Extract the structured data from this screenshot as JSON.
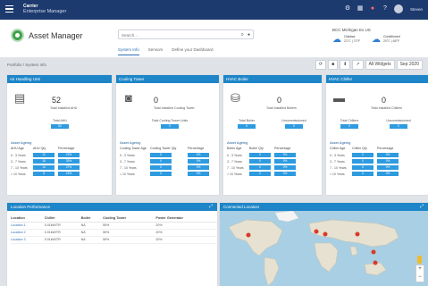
{
  "topbar": {
    "brand_line1": "Carrier",
    "brand_line2": "Enterprise Manager",
    "user_name": "Steven",
    "icons": [
      "settings-icon",
      "grid-icon",
      "alert-icon",
      "help-icon"
    ]
  },
  "header": {
    "app_title": "Asset Manager",
    "search_placeholder": "Search...",
    "tabs": [
      "System Info",
      "Sensors",
      "Define your Dashboard"
    ],
    "site_name": "BCC Michigan Ex US",
    "weather": [
      {
        "label": "Outdoor",
        "value": "21°C | 70°F"
      },
      {
        "label": "Conditioned",
        "value": "20°C | 68°F"
      }
    ]
  },
  "breadcrumb": "Portfolio / System Info",
  "toolbar": {
    "widgets_label": "All Widgets",
    "date_label": "Sep 2020"
  },
  "cards": [
    {
      "title": "Air Handling Unit",
      "icon": "ahu-icon",
      "count": "52",
      "count_label": "Total Installed AHU",
      "sub_label": "Total AHU",
      "sub_value": "52",
      "aging_title": "Asset Ageing",
      "headers": [
        "AHU Age",
        "AHU Qty",
        "Percentage"
      ],
      "rows": [
        [
          "0 - 3 Years",
          "12",
          "23%"
        ],
        [
          "3 - 7 Years",
          "18",
          "35%"
        ],
        [
          "7 - 10 Years",
          "14",
          "27%"
        ],
        [
          "> 10 Years",
          "8",
          "15%"
        ]
      ]
    },
    {
      "title": "Cooling Tower",
      "icon": "cooling-tower-icon",
      "count": "0",
      "count_label": "Total Installed Cooling Tower",
      "sub_label": "Total Cooling Tower Units",
      "sub_value": "0",
      "aging_title": "Asset Ageing",
      "headers": [
        "Cooling Tower Age",
        "Cooling Tower Qty",
        "Percentage"
      ],
      "rows": [
        [
          "0 - 3 Years",
          "0",
          "0%"
        ],
        [
          "3 - 7 Years",
          "0",
          "0%"
        ],
        [
          "7 - 10 Years",
          "0",
          "0%"
        ],
        [
          "> 10 Years",
          "0",
          "0%"
        ]
      ]
    },
    {
      "title": "HVAC Boiler",
      "icon": "boiler-icon",
      "count": "0",
      "count_label": "Total Installed Boilers",
      "sub_labels": [
        "Total Boiler",
        "Uncommissioned"
      ],
      "sub_values": [
        "0",
        "0"
      ],
      "aging_title": "Asset Ageing",
      "headers": [
        "Boiler Age",
        "Boiler Qty",
        "Percentage"
      ],
      "rows": [
        [
          "0 - 3 Years",
          "0",
          "0%"
        ],
        [
          "3 - 7 Years",
          "0",
          "0%"
        ],
        [
          "7 - 10 Years",
          "0",
          "0%"
        ],
        [
          "> 10 Years",
          "0",
          "0%"
        ]
      ]
    },
    {
      "title": "HVAC Chiller",
      "icon": "chiller-icon",
      "count": "0",
      "count_label": "Total Installed Chillers",
      "sub_labels": [
        "Total Chillers",
        "Uncommissioned"
      ],
      "sub_values": [
        "0",
        "0"
      ],
      "aging_title": "Asset Ageing",
      "headers": [
        "Chiller Age",
        "Chiller Qty",
        "Percentage"
      ],
      "rows": [
        [
          "0 - 3 Years",
          "0",
          "0%"
        ],
        [
          "3 - 7 Years",
          "0",
          "0%"
        ],
        [
          "7 - 10 Years",
          "0",
          "0%"
        ],
        [
          "> 10 Years",
          "0",
          "0%"
        ]
      ]
    }
  ],
  "location_panel": {
    "title": "Location Performance",
    "headers": [
      "Location",
      "Chiller",
      "Boiler",
      "Cooling Tower",
      "Power Generator"
    ],
    "rows": [
      [
        "Location 1",
        "0.01kW/TR",
        "NA",
        "50%",
        "20%"
      ],
      [
        "Location 2",
        "0.01kW/TR",
        "NA",
        "50%",
        "20%"
      ],
      [
        "Location 3",
        "0.01kW/TR",
        "NA",
        "50%",
        "20%"
      ]
    ]
  },
  "map_panel": {
    "title": "Connected Location"
  }
}
